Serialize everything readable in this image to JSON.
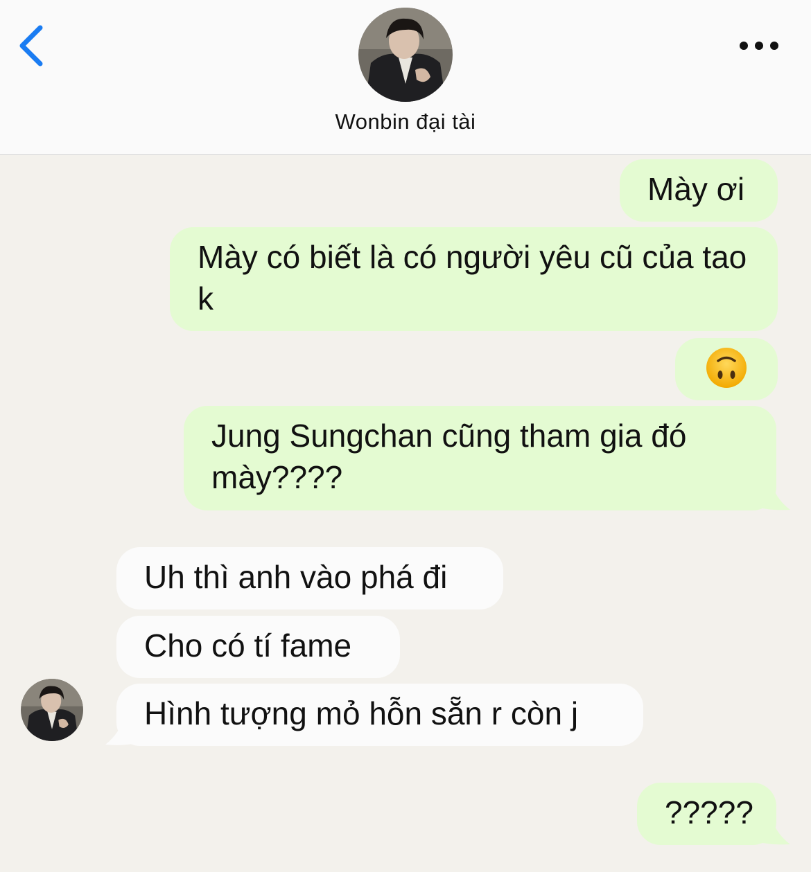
{
  "header": {
    "back_icon": "chevron-left-icon",
    "more_icon": "ellipsis-icon",
    "contact_name": "Wonbin đại tài",
    "accent_color": "#1a7cf2"
  },
  "messages": [
    {
      "from": "me",
      "text": "Mày ơi"
    },
    {
      "from": "me",
      "text": "Mày có biết là có người yêu cũ của tao k"
    },
    {
      "from": "me",
      "text": "🙃"
    },
    {
      "from": "me",
      "text": "Jung Sungchan cũng tham gia đó mày????"
    },
    {
      "from": "contact",
      "text": "Uh thì anh vào phá đi"
    },
    {
      "from": "contact",
      "text": "Cho có tí fame"
    },
    {
      "from": "contact",
      "text": "Hình tượng mỏ hỗn sẵn r còn j"
    },
    {
      "from": "me",
      "text": "?????"
    }
  ],
  "colors": {
    "outgoing_bubble": "#e4fbd2",
    "incoming_bubble": "#fbfbfb",
    "chat_background": "#f3f1ec"
  }
}
